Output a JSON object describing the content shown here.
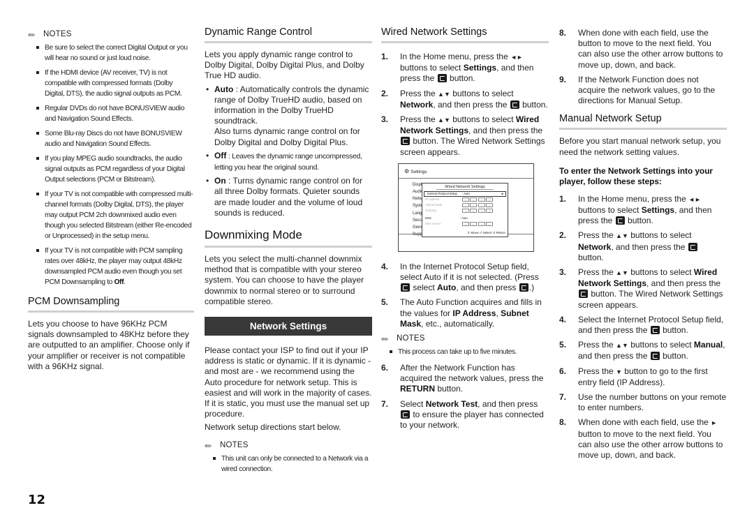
{
  "page_number": "12",
  "icons": {
    "notes": "pencil-icon",
    "enter_button": "enter-button-icon",
    "gear": "gear-icon"
  },
  "col1": {
    "notes_label": "NOTES",
    "notes": [
      "Be sure to select the correct Digital Output or you will hear no sound or just loud noise.",
      "If the HDMI device (AV receiver, TV) is not compatible with compressed formats (Dolby Digital, DTS), the audio signal outputs as PCM.",
      "Regular DVDs do not have BONUSVIEW audio and Navigation Sound Effects.",
      "Some Blu-ray Discs do not have BONUSVIEW audio and Navigation Sound Effects.",
      "If you play MPEG audio soundtracks, the audio signal outputs as PCM regardless of your Digital Output selections (PCM or Bitstream).",
      "If your TV is not compatible with compressed multi-channel formats (Dolby Digital, DTS), the player may output PCM 2ch downmixed audio even though you selected Bitstream (either Re-encoded or Unprocessed) in the setup menu."
    ],
    "last_note_pre": "If your TV is not compatible with PCM sampling rates over 48kHz, the player may output 48kHz downsampled PCM audio even though you set PCM Downsampling to ",
    "last_note_bold": "Off",
    "last_note_post": ".",
    "pcm_title": "PCM Downsampling",
    "pcm_body": "Lets you choose to have 96KHz PCM signals downsampled to 48KHz before they are outputted to an amplifier. Choose only if your amplifier or receiver is not compatible with a 96KHz signal."
  },
  "col2": {
    "drc_title": "Dynamic Range Control",
    "drc_body": "Lets you apply dynamic range control to Dolby Digital, Dolby Digital Plus, and Dolby True HD audio.",
    "drc_options": [
      {
        "name": "Auto",
        "desc": " : Automatically controls the dynamic range of Dolby TrueHD audio, based on information in the Dolby TrueHD soundtrack.",
        "extra": "Also turns dynamic range control on for Dolby Digital and Dolby Digital Plus."
      },
      {
        "name": "Off",
        "desc": " : Leaves the dynamic range uncompressed, letting you hear the original sound."
      },
      {
        "name": "On",
        "desc": " : Turns dynamic range control on for all three Dolby formats. Quieter sounds are made louder and the volume of loud sounds is reduced."
      }
    ],
    "downmix_title": "Downmixing Mode",
    "downmix_body": "Lets you select the multi-channel downmix method that is compatible with your stereo system. You can choose to have the player downmix to normal stereo or to surround compatible stereo.",
    "network_banner": "Network Settings",
    "network_body": "Please contact your ISP to find out if your IP address is static or dynamic. If it is dynamic - and most are - we recommend using the Auto procedure for network setup. This is easiest and will work in the majority of cases. If it is static, you must use the manual set up procedure.",
    "network_body2": "Network setup directions start below.",
    "notes_label": "NOTES",
    "notes": [
      "This unit can only be connected to a Network via a wired connection."
    ]
  },
  "col3": {
    "title": "Wired Network Settings",
    "steps": [
      {
        "n": "1.",
        "a": "In the Home menu, press the ",
        "arrows": "◄►",
        "b": " buttons to select ",
        "bold": "Settings",
        "c": ", and then press the ",
        "d": " button."
      },
      {
        "n": "2.",
        "a": "Press the ",
        "arrows": "▲▼",
        "b": " buttons to select ",
        "bold": "Network",
        "c": ", and then press the ",
        "d": " button."
      },
      {
        "n": "3.",
        "a": "Press the ",
        "arrows": "▲▼",
        "b": " buttons to select ",
        "bold": "Wired Network Settings",
        "c": ", and then press the ",
        "d": " button. The Wired Network Settings screen appears."
      }
    ],
    "screen": {
      "header": "Settings",
      "menu": [
        "Display",
        "Audio",
        "Network",
        "System",
        "Language",
        "Security",
        "General",
        "Support"
      ],
      "popup_title": "Wired Network Settings",
      "rows": [
        {
          "label": "Internet Protocol Setup",
          "value": ": Auto",
          "arrow": "►"
        },
        {
          "label": "IP Address",
          "boxes": [
            "0",
            "0",
            "0",
            "0"
          ]
        },
        {
          "label": "Subnet Mask",
          "boxes": [
            "0",
            "0",
            "0",
            "0"
          ]
        },
        {
          "label": "Gateway",
          "boxes": [
            "0",
            "0",
            "0",
            "0"
          ]
        },
        {
          "label": "DNS",
          "value": ": Auto"
        },
        {
          "label": "DNS Server",
          "boxes": [
            "0",
            "0",
            "0",
            "0"
          ]
        }
      ],
      "footer": "⇕ Move  ⏎ Select  ↺ Return"
    },
    "step4": {
      "n": "4.",
      "a": "In the Internet Protocol Setup field, select Auto if it is not selected. (Press ",
      "b": " select ",
      "bold": "Auto",
      "c": ", and then press ",
      "d": ".)"
    },
    "step5": {
      "n": "5.",
      "a": "The Auto Function acquires and fills in the values for ",
      "bold1": "IP Address",
      "b": ", ",
      "bold2": "Subnet Mask",
      "c": ", etc., automatically."
    },
    "notes_label": "NOTES",
    "notes": [
      "This process can take up to five minutes."
    ],
    "step6": {
      "n": "6.",
      "a": "After the Network Function has acquired the network values, press the ",
      "bold": "RETURN",
      "b": " button."
    },
    "step7": {
      "n": "7.",
      "a": "Select ",
      "bold": "Network Test",
      "b": ", and then press ",
      "c": " to ensure the player has connected to your network."
    }
  },
  "col4": {
    "step8": {
      "n": "8.",
      "a": "When done with each field, use the ",
      "arrows": "►",
      "b": " button to move to the next field. You can also use the other arrow buttons to move up, down, and back."
    },
    "step9": {
      "n": "9.",
      "a": "If the Network Function does not acquire the network values, go to the directions for Manual Setup."
    },
    "manual_title": "Manual Network Setup",
    "manual_body": "Before you start manual network setup, you need the network setting values.",
    "sub_heading": "To enter the Network Settings into your player, follow these steps:",
    "steps": [
      {
        "n": "1.",
        "a": "In the Home menu, press the ",
        "arrows": "◄►",
        "b": " buttons to select ",
        "bold": "Settings",
        "c": ", and then press the ",
        "d": " button."
      },
      {
        "n": "2.",
        "a": "Press the ",
        "arrows": "▲▼",
        "b": " buttons to select ",
        "bold": "Network",
        "c": ", and then press the ",
        "d": " button."
      },
      {
        "n": "3.",
        "a": "Press the ",
        "arrows": "▲▼",
        "b": " buttons to select ",
        "bold": "Wired Network Settings",
        "c": ", and then press the ",
        "d": " button. The Wired Network Settings screen appears."
      },
      {
        "n": "4.",
        "a": "Select the Internet Protocol Setup field, and then press the ",
        "d": " button."
      },
      {
        "n": "5.",
        "a": "Press the ",
        "arrows": "▲▼",
        "b": " buttons to select ",
        "bold": "Manual",
        "c": ", and then press the ",
        "d": " button."
      }
    ],
    "step6": {
      "n": "6.",
      "a": "Press the ",
      "arrows": "▼",
      "b": " button to go to the first entry field (IP Address)."
    },
    "step7": {
      "n": "7.",
      "a": "Use the number buttons on your remote to enter numbers."
    }
  }
}
